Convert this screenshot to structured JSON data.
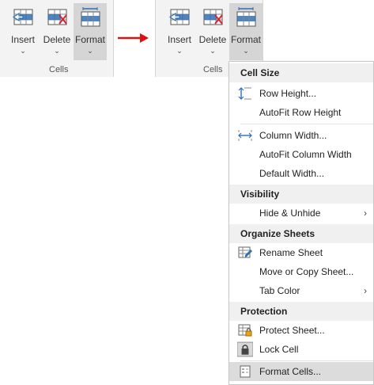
{
  "ribbon_left": {
    "buttons": [
      {
        "label": "Insert",
        "chevron": "⌄"
      },
      {
        "label": "Delete",
        "chevron": "⌄"
      },
      {
        "label": "Format",
        "chevron": "⌄"
      }
    ],
    "group_label": "Cells"
  },
  "ribbon_right": {
    "buttons": [
      {
        "label": "Insert",
        "chevron": "⌄"
      },
      {
        "label": "Delete",
        "chevron": "⌄"
      },
      {
        "label": "Format",
        "chevron": "⌄"
      }
    ],
    "group_label": "Cells"
  },
  "menu": {
    "cell_size": {
      "header": "Cell Size",
      "row_height": "Row Height...",
      "autofit_row_height": "AutoFit Row Height",
      "column_width": "Column Width...",
      "autofit_column_width": "AutoFit Column Width",
      "default_width": "Default Width..."
    },
    "visibility": {
      "header": "Visibility",
      "hide_unhide": "Hide & Unhide"
    },
    "organize": {
      "header": "Organize Sheets",
      "rename_sheet": "Rename Sheet",
      "move_copy": "Move or Copy Sheet...",
      "tab_color": "Tab Color"
    },
    "protection": {
      "header": "Protection",
      "protect_sheet": "Protect Sheet...",
      "lock_cell": "Lock Cell",
      "format_cells": "Format Cells..."
    },
    "submenu_arrow": "›"
  },
  "colors": {
    "arrow": "#e01010",
    "icon_blue": "#2f6fb5",
    "icon_red": "#d9232e",
    "highlight": "#dcdcdc"
  }
}
